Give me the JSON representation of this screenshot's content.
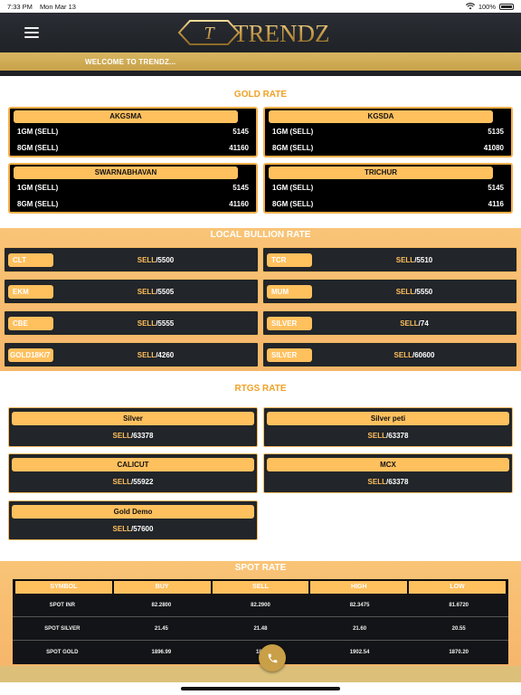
{
  "status": {
    "time": "7:33 PM",
    "date": "Mon Mar 13",
    "battery": "100%"
  },
  "header": {
    "logo_letter": "T",
    "logo_text": "TRENDZ"
  },
  "welcome": "WELCOME TO TRENDZ...",
  "gold": {
    "title": "GOLD RATE",
    "cards": [
      {
        "name": "AKGSMA",
        "r1_label": "1GM (SELL)",
        "r1_val": "5145",
        "r2_label": "8GM (SELL)",
        "r2_val": "41160"
      },
      {
        "name": "KGSDA",
        "r1_label": "1GM (SELL)",
        "r1_val": "5135",
        "r2_label": "8GM (SELL)",
        "r2_val": "41080"
      },
      {
        "name": "SWARNABHAVAN",
        "r1_label": "1GM (SELL)",
        "r1_val": "5145",
        "r2_label": "8GM (SELL)",
        "r2_val": "41160"
      },
      {
        "name": "TRICHUR",
        "r1_label": "1GM (SELL)",
        "r1_val": "5145",
        "r2_label": "8GM (SELL)",
        "r2_val": "4116"
      }
    ]
  },
  "bullion": {
    "title": "LOCAL BULLION RATE",
    "sell_label": "SELL",
    "items": [
      {
        "tag": "CLT",
        "val": "/5500"
      },
      {
        "tag": "TCR",
        "val": "/5510"
      },
      {
        "tag": "EKM",
        "val": "/5505"
      },
      {
        "tag": "MUM",
        "val": "/5550"
      },
      {
        "tag": "CBE",
        "val": "/5555"
      },
      {
        "tag": "SILVER",
        "val": "/74"
      },
      {
        "tag": "GOLD18K/7",
        "val": "/4260"
      },
      {
        "tag": "SILVER",
        "val": "/60600"
      }
    ]
  },
  "rtgs": {
    "title": "RTGS RATE",
    "sell_label": "SELL",
    "items": [
      {
        "name": "Silver",
        "val": "/63378"
      },
      {
        "name": "Silver peti",
        "val": "/63378"
      },
      {
        "name": "CALICUT",
        "val": "/55922"
      },
      {
        "name": "MCX",
        "val": "/63378"
      },
      {
        "name": "Gold Demo",
        "val": "/57600"
      }
    ]
  },
  "spot": {
    "title": "SPOT RATE",
    "columns": [
      "SYMBOL",
      "BUY",
      "SELL",
      "HIGH",
      "LOW"
    ],
    "rows": [
      [
        "SPOT INR",
        "82.2800",
        "82.2900",
        "82.3475",
        "81.6720"
      ],
      [
        "SPOT SILVER",
        "21.45",
        "21.48",
        "21.60",
        "20.55"
      ],
      [
        "SPOT GOLD",
        "1896.99",
        "189",
        "1902.54",
        "1870.20"
      ]
    ]
  },
  "colors": {
    "accent": "#f0a125",
    "tag": "#ffc05e",
    "dark": "#222529"
  }
}
